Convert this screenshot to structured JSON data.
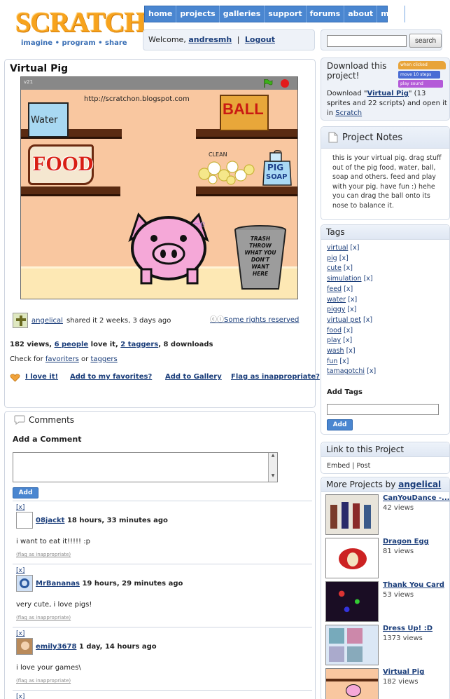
{
  "header": {
    "logo_text": "SCRATCH",
    "tagline": "imagine • program • share",
    "nav": [
      "home",
      "projects",
      "galleries",
      "support",
      "forums",
      "about",
      "my stuff"
    ],
    "welcome_prefix": "Welcome,",
    "username": "andresmh",
    "separator": "|",
    "logout": "Logout",
    "search_placeholder": "",
    "search_button": "search"
  },
  "project": {
    "title": "Virtual Pig",
    "stage": {
      "version": "v21",
      "url": "http://scratchon.blogspot.com",
      "labels": {
        "water": "Water",
        "ball": "BALL",
        "food": "FOOD",
        "clean": "CLEAN",
        "pig_soap_1": "PIG",
        "pig_soap_2": "SOAP",
        "trash": [
          "TRASH",
          "THROW",
          "WHAT YOU",
          "DON'T",
          "WANT",
          "HERE"
        ]
      }
    },
    "shared_by": "angelical",
    "shared_when": "shared it 2 weeks, 3 days ago",
    "rights": "Some rights reserved",
    "stats": {
      "views": "182 views,",
      "love_link": "6 people",
      "love_suffix": "love it,",
      "taggers_link": "2 taggers",
      "downloads": ", 8 downloads"
    },
    "check_prefix": "Check for",
    "favoriters": "favoriters",
    "or": "or",
    "taggers": "taggers",
    "actions": {
      "love": "I love it!",
      "favorites": "Add to my favorites?",
      "gallery": "Add to Gallery",
      "flag": "Flag as inappropriate?"
    }
  },
  "comments": {
    "header": "Comments",
    "add_title": "Add a Comment",
    "add_button": "Add",
    "items": [
      {
        "x": "[x]",
        "user": "08jackt",
        "when": "18 hours, 33 minutes ago",
        "text": "i want to eat it!!!!! :p",
        "flag": "(flag as inappropriate)"
      },
      {
        "x": "[x]",
        "user": "MrBananas",
        "when": "19 hours, 29 minutes ago",
        "text": "very cute, i love pigs!",
        "flag": "(flag as inappropriate)"
      },
      {
        "x": "[x]",
        "user": "emily3678",
        "when": "1 day, 14 hours ago",
        "text": "i love your games\\",
        "flag": "(flag as inappropriate)"
      }
    ],
    "next_x": "[x]"
  },
  "sidebar": {
    "download": {
      "title": "Download this project!",
      "prefix": "Download \"",
      "link": "Virtual Pig",
      "middle": "\" (13 sprites and 22 scripts) and open it in ",
      "scratch_link": "Scratch",
      "blocks": [
        "when clicked",
        "move 10 steps",
        "play sound"
      ]
    },
    "notes": {
      "title": "Project Notes",
      "text": "this is your virtual pig. drag stuff out of the pig food, water, ball, soap and others. feed and play with your pig. have fun :) hehe you can drag the ball onto its nose to balance it."
    },
    "tags": {
      "title": "Tags",
      "items": [
        "virtual",
        "pig",
        "cute",
        "simulation",
        "feed",
        "water",
        "piggy",
        "virtual pet",
        "food",
        "play",
        "wash",
        "fun",
        "tamagotchi"
      ],
      "remove": "[x]",
      "add_label": "Add Tags",
      "add_button": "Add"
    },
    "link": {
      "title": "Link to this Project",
      "embed": "Embed",
      "sep": "|",
      "post": "Post"
    },
    "more": {
      "title_prefix": "More Projects by",
      "user": "angelical",
      "items": [
        {
          "title": "CanYouDance -...",
          "views": "42 views"
        },
        {
          "title": "Dragon Egg",
          "views": "81 views"
        },
        {
          "title": "Thank You Card",
          "views": "53 views"
        },
        {
          "title": "Dress Up! :D",
          "views": "1373 views"
        },
        {
          "title": "Virtual Pig",
          "views": "182 views"
        }
      ]
    }
  }
}
